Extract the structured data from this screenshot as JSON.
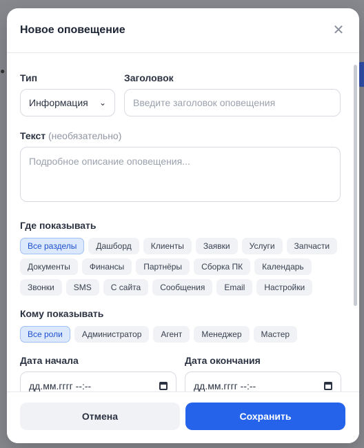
{
  "modal": {
    "title": "Новое оповещение",
    "close_icon": "close-icon"
  },
  "form": {
    "type_label": "Тип",
    "type_value": "Информация",
    "title_label": "Заголовок",
    "title_placeholder": "Введите заголовок оповещения",
    "text_label": "Текст",
    "text_optional": "(необязательно)",
    "text_placeholder": "Подробное описание оповещения...",
    "where_label": "Где показывать",
    "where_options": [
      "Все разделы",
      "Дашборд",
      "Клиенты",
      "Заявки",
      "Услуги",
      "Запчасти",
      "Документы",
      "Финансы",
      "Партнёры",
      "Сборка ПК",
      "Календарь",
      "Звонки",
      "SMS",
      "С сайта",
      "Сообщения",
      "Email",
      "Настройки"
    ],
    "where_selected": "Все разделы",
    "who_label": "Кому показывать",
    "who_options": [
      "Все роли",
      "Администратор",
      "Агент",
      "Менеджер",
      "Мастер"
    ],
    "who_selected": "Все роли",
    "start_label": "Дата начала",
    "start_value": "дд.мм.гггг --:--",
    "end_label": "Дата окончания",
    "end_value": "дд.мм.гггг --:--"
  },
  "footer": {
    "cancel_label": "Отмена",
    "save_label": "Сохранить"
  },
  "colors": {
    "accent": "#2563eb",
    "chip_active_bg": "#dce8fb"
  }
}
